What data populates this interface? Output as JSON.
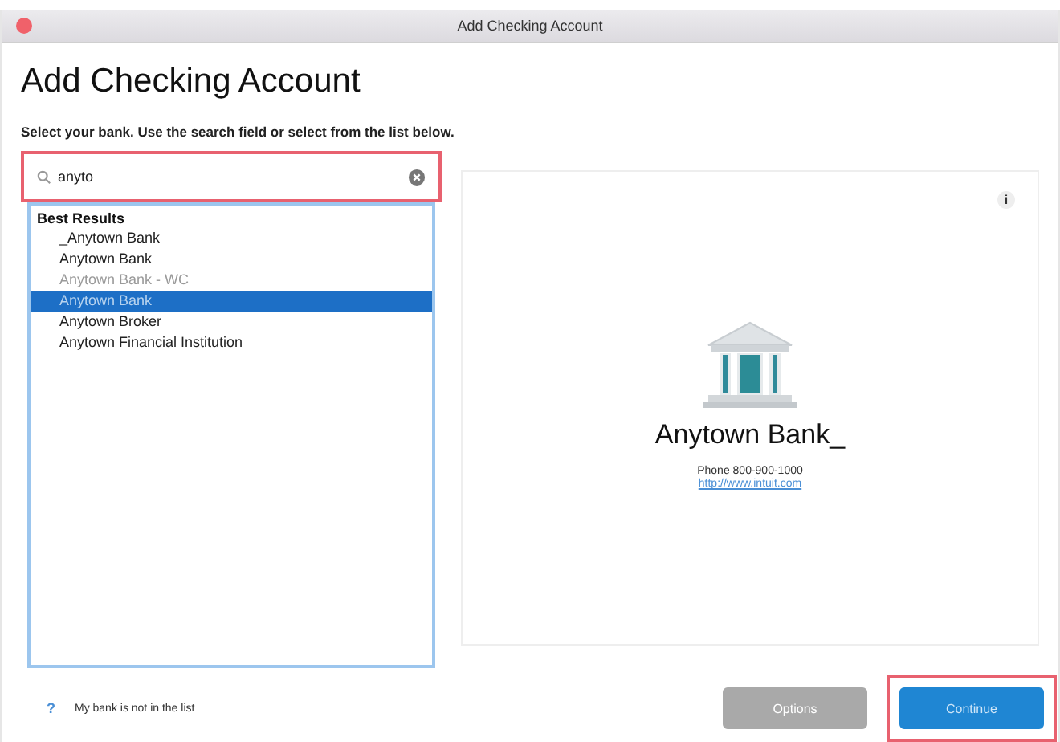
{
  "window": {
    "title": "Add Checking Account"
  },
  "heading": "Add Checking Account",
  "instruction": "Select your bank. Use the search field or select from the list below.",
  "search": {
    "value": "anyto",
    "highlighted": true
  },
  "results": {
    "header": "Best Results",
    "items": [
      {
        "label": "_Anytown Bank",
        "selected": false,
        "disabled": false
      },
      {
        "label": "Anytown Bank",
        "selected": false,
        "disabled": false
      },
      {
        "label": "Anytown Bank - WC",
        "selected": false,
        "disabled": true
      },
      {
        "label": "Anytown Bank",
        "selected": true,
        "disabled": false
      },
      {
        "label": "Anytown Broker",
        "selected": false,
        "disabled": false
      },
      {
        "label": "Anytown Financial Institution",
        "selected": false,
        "disabled": false
      }
    ]
  },
  "details": {
    "info": "i",
    "name": "Anytown Bank_",
    "phone": "Phone  800-900-1000",
    "url": "http://www.intuit.com"
  },
  "help": {
    "icon": "?",
    "label": "My bank is not in the list"
  },
  "buttons": [
    {
      "label": "Options",
      "disabled": true,
      "kind": "secondary",
      "highlighted": false
    },
    {
      "label": "Continue",
      "disabled": false,
      "kind": "primary",
      "highlighted": true
    }
  ]
}
